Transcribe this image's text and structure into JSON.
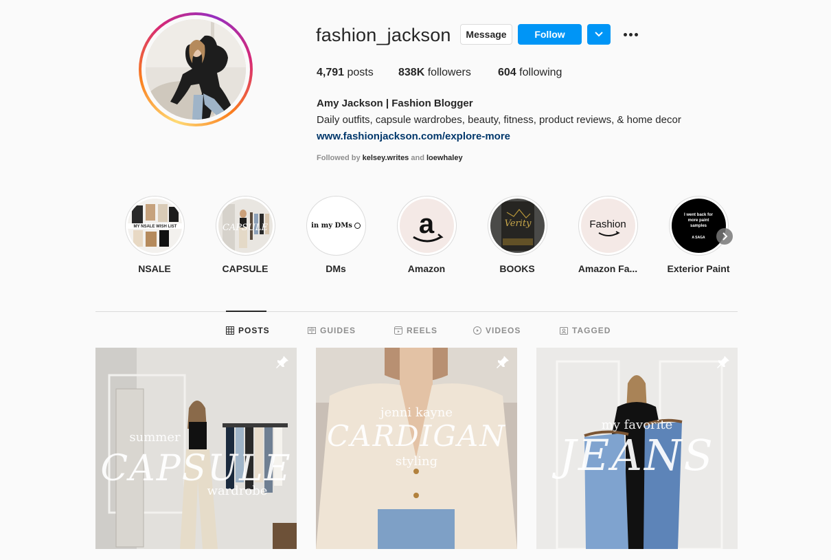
{
  "profile": {
    "username": "fashion_jackson",
    "message_label": "Message",
    "follow_label": "Follow",
    "posts_count": "4,791",
    "posts_label": "posts",
    "followers_count": "838K",
    "followers_label": "followers",
    "following_count": "604",
    "following_label": "following",
    "full_name": "Amy Jackson | Fashion Blogger",
    "bio": "Daily outfits, capsule wardrobes, beauty, fitness, product reviews, & home decor",
    "website": "www.fashionjackson.com/explore-more",
    "followed_by_prefix": "Followed by",
    "followed_by_1": "kelsey.writes",
    "followed_by_and": "and",
    "followed_by_2": "loewhaley"
  },
  "highlights": [
    {
      "label": "NSALE",
      "cover_text": "MY NSALE WISH LIST"
    },
    {
      "label": "CAPSULE",
      "cover_text": "CAPSULE"
    },
    {
      "label": "DMs",
      "cover_text": "in my DMs"
    },
    {
      "label": "Amazon",
      "cover_text": "a"
    },
    {
      "label": "BOOKS",
      "cover_text": "Verity"
    },
    {
      "label": "Amazon Fa...",
      "cover_text": "Fashion"
    },
    {
      "label": "Exterior Paint",
      "cover_text": "I went back for more paint samples",
      "cover_sub": "A SAGA"
    }
  ],
  "tabs": [
    {
      "label": "POSTS",
      "icon": "grid-icon",
      "active": true
    },
    {
      "label": "GUIDES",
      "icon": "guide-icon",
      "active": false
    },
    {
      "label": "REELS",
      "icon": "reels-icon",
      "active": false
    },
    {
      "label": "VIDEOS",
      "icon": "play-icon",
      "active": false
    },
    {
      "label": "TAGGED",
      "icon": "tagged-icon",
      "active": false
    }
  ],
  "posts": [
    {
      "small_top": "summer",
      "big": "CAPSULE",
      "small_bottom": "wardrobe",
      "pinned": true
    },
    {
      "small_top": "jenni kayne",
      "big": "CARDIGAN",
      "small_bottom": "styling",
      "pinned": true
    },
    {
      "small_top": "my favorite",
      "big": "JEANS",
      "small_bottom": "",
      "pinned": true
    }
  ],
  "colors": {
    "accent": "#0095f6",
    "link": "#00376b",
    "muted": "#8e8e8e",
    "text": "#262626"
  }
}
